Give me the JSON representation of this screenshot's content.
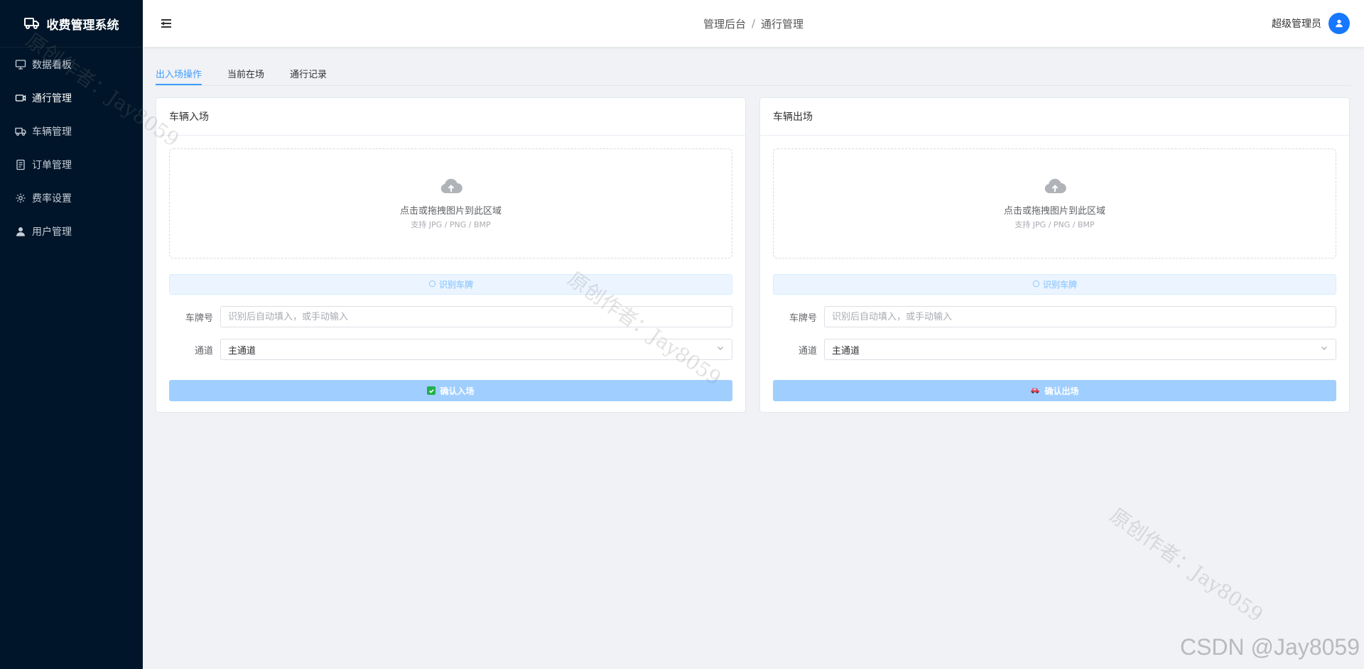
{
  "app": {
    "title": "收费管理系统"
  },
  "sidebar": {
    "items": [
      {
        "label": "数据看板",
        "icon": "monitor-icon",
        "active": false
      },
      {
        "label": "通行管理",
        "icon": "video-camera-icon",
        "active": true
      },
      {
        "label": "车辆管理",
        "icon": "truck-icon",
        "active": false
      },
      {
        "label": "订单管理",
        "icon": "document-icon",
        "active": false
      },
      {
        "label": "费率设置",
        "icon": "gear-icon",
        "active": false
      },
      {
        "label": "用户管理",
        "icon": "user-icon",
        "active": false
      }
    ]
  },
  "header": {
    "breadcrumb": [
      "管理后台",
      "通行管理"
    ],
    "breadcrumb_sep": "/",
    "user_name": "超级管理员"
  },
  "tabs": [
    {
      "label": "出入场操作",
      "active": true
    },
    {
      "label": "当前在场",
      "active": false
    },
    {
      "label": "通行记录",
      "active": false
    }
  ],
  "entry_card": {
    "title": "车辆入场",
    "upload_text": "点击或拖拽图片到此区域",
    "upload_hint": "支持 JPG / PNG / BMP",
    "recognize_label": "识别车牌",
    "plate_label": "车牌号",
    "plate_placeholder": "识别后自动填入，或手动输入",
    "plate_value": "",
    "channel_label": "通道",
    "channel_value": "主通道",
    "confirm_label": "确认入场"
  },
  "exit_card": {
    "title": "车辆出场",
    "upload_text": "点击或拖拽图片到此区域",
    "upload_hint": "支持 JPG / PNG / BMP",
    "recognize_label": "识别车牌",
    "plate_label": "车牌号",
    "plate_placeholder": "识别后自动填入，或手动输入",
    "plate_value": "",
    "channel_label": "通道",
    "channel_value": "主通道",
    "confirm_label": "确认出场"
  },
  "watermark": {
    "text": "原创作者：Jay8059",
    "csdn": "CSDN @Jay8059"
  },
  "colors": {
    "sidebar_bg": "#001529",
    "accent": "#409eff",
    "primary_light": "#a0cfff",
    "avatar": "#1677ff"
  }
}
